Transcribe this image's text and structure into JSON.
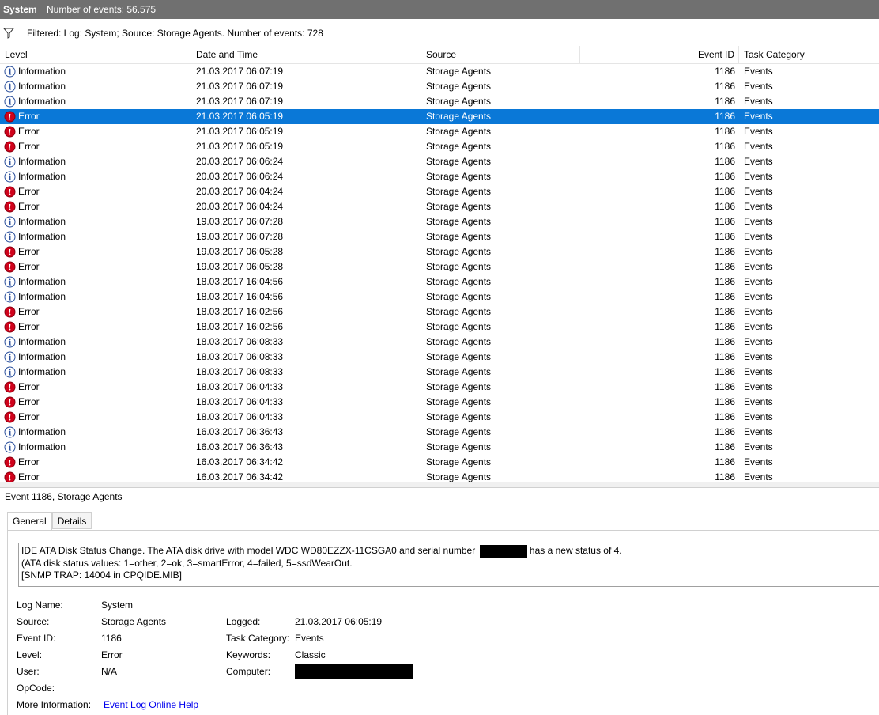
{
  "titlebar": {
    "name": "System",
    "count": "Number of events: 56.575"
  },
  "filter": {
    "text": "Filtered: Log: System; Source: Storage Agents. Number of events: 728"
  },
  "columns": {
    "level": "Level",
    "date": "Date and Time",
    "source": "Source",
    "event_id": "Event ID",
    "category": "Task Category"
  },
  "rows": [
    {
      "level": "Information",
      "date": "21.03.2017 06:07:19",
      "source": "Storage Agents",
      "id": "1186",
      "category": "Events"
    },
    {
      "level": "Information",
      "date": "21.03.2017 06:07:19",
      "source": "Storage Agents",
      "id": "1186",
      "category": "Events"
    },
    {
      "level": "Information",
      "date": "21.03.2017 06:07:19",
      "source": "Storage Agents",
      "id": "1186",
      "category": "Events"
    },
    {
      "level": "Error",
      "date": "21.03.2017 06:05:19",
      "source": "Storage Agents",
      "id": "1186",
      "category": "Events",
      "selected": true
    },
    {
      "level": "Error",
      "date": "21.03.2017 06:05:19",
      "source": "Storage Agents",
      "id": "1186",
      "category": "Events"
    },
    {
      "level": "Error",
      "date": "21.03.2017 06:05:19",
      "source": "Storage Agents",
      "id": "1186",
      "category": "Events"
    },
    {
      "level": "Information",
      "date": "20.03.2017 06:06:24",
      "source": "Storage Agents",
      "id": "1186",
      "category": "Events"
    },
    {
      "level": "Information",
      "date": "20.03.2017 06:06:24",
      "source": "Storage Agents",
      "id": "1186",
      "category": "Events"
    },
    {
      "level": "Error",
      "date": "20.03.2017 06:04:24",
      "source": "Storage Agents",
      "id": "1186",
      "category": "Events"
    },
    {
      "level": "Error",
      "date": "20.03.2017 06:04:24",
      "source": "Storage Agents",
      "id": "1186",
      "category": "Events"
    },
    {
      "level": "Information",
      "date": "19.03.2017 06:07:28",
      "source": "Storage Agents",
      "id": "1186",
      "category": "Events"
    },
    {
      "level": "Information",
      "date": "19.03.2017 06:07:28",
      "source": "Storage Agents",
      "id": "1186",
      "category": "Events"
    },
    {
      "level": "Error",
      "date": "19.03.2017 06:05:28",
      "source": "Storage Agents",
      "id": "1186",
      "category": "Events"
    },
    {
      "level": "Error",
      "date": "19.03.2017 06:05:28",
      "source": "Storage Agents",
      "id": "1186",
      "category": "Events"
    },
    {
      "level": "Information",
      "date": "18.03.2017 16:04:56",
      "source": "Storage Agents",
      "id": "1186",
      "category": "Events"
    },
    {
      "level": "Information",
      "date": "18.03.2017 16:04:56",
      "source": "Storage Agents",
      "id": "1186",
      "category": "Events"
    },
    {
      "level": "Error",
      "date": "18.03.2017 16:02:56",
      "source": "Storage Agents",
      "id": "1186",
      "category": "Events"
    },
    {
      "level": "Error",
      "date": "18.03.2017 16:02:56",
      "source": "Storage Agents",
      "id": "1186",
      "category": "Events"
    },
    {
      "level": "Information",
      "date": "18.03.2017 06:08:33",
      "source": "Storage Agents",
      "id": "1186",
      "category": "Events"
    },
    {
      "level": "Information",
      "date": "18.03.2017 06:08:33",
      "source": "Storage Agents",
      "id": "1186",
      "category": "Events"
    },
    {
      "level": "Information",
      "date": "18.03.2017 06:08:33",
      "source": "Storage Agents",
      "id": "1186",
      "category": "Events"
    },
    {
      "level": "Error",
      "date": "18.03.2017 06:04:33",
      "source": "Storage Agents",
      "id": "1186",
      "category": "Events"
    },
    {
      "level": "Error",
      "date": "18.03.2017 06:04:33",
      "source": "Storage Agents",
      "id": "1186",
      "category": "Events"
    },
    {
      "level": "Error",
      "date": "18.03.2017 06:04:33",
      "source": "Storage Agents",
      "id": "1186",
      "category": "Events"
    },
    {
      "level": "Information",
      "date": "16.03.2017 06:36:43",
      "source": "Storage Agents",
      "id": "1186",
      "category": "Events"
    },
    {
      "level": "Information",
      "date": "16.03.2017 06:36:43",
      "source": "Storage Agents",
      "id": "1186",
      "category": "Events"
    },
    {
      "level": "Error",
      "date": "16.03.2017 06:34:42",
      "source": "Storage Agents",
      "id": "1186",
      "category": "Events"
    },
    {
      "level": "Error",
      "date": "16.03.2017 06:34:42",
      "source": "Storage Agents",
      "id": "1186",
      "category": "Events"
    }
  ],
  "detail": {
    "title": "Event 1186, Storage Agents",
    "tabs": {
      "general": "General",
      "details": "Details"
    },
    "message": {
      "line1_a": "IDE ATA Disk Status Change.  The ATA disk drive with model WDC WD80EZZX-11CSGA0 and serial number",
      "line1_b": "has a new status of 4.",
      "line2": "(ATA disk status values: 1=other, 2=ok, 3=smartError, 4=failed, 5=ssdWearOut.",
      "line3": "[SNMP TRAP: 14004 in CPQIDE.MIB]"
    },
    "labels": {
      "log_name": "Log Name:",
      "source": "Source:",
      "event_id": "Event ID:",
      "level": "Level:",
      "user": "User:",
      "opcode": "OpCode:",
      "more_info": "More Information:",
      "logged": "Logged:",
      "task_category": "Task Category:",
      "keywords": "Keywords:",
      "computer": "Computer:"
    },
    "values": {
      "log_name": "System",
      "source": "Storage Agents",
      "event_id": "1186",
      "level": "Error",
      "user": "N/A",
      "logged": "21.03.2017 06:05:19",
      "task_category": "Events",
      "keywords": "Classic",
      "more_info_link": "Event Log Online Help"
    }
  },
  "colors": {
    "selected_row": "#0a78d7",
    "titlebar": "#707070",
    "error_icon": "#d0021b",
    "info_icon": "#2a4f9c"
  }
}
